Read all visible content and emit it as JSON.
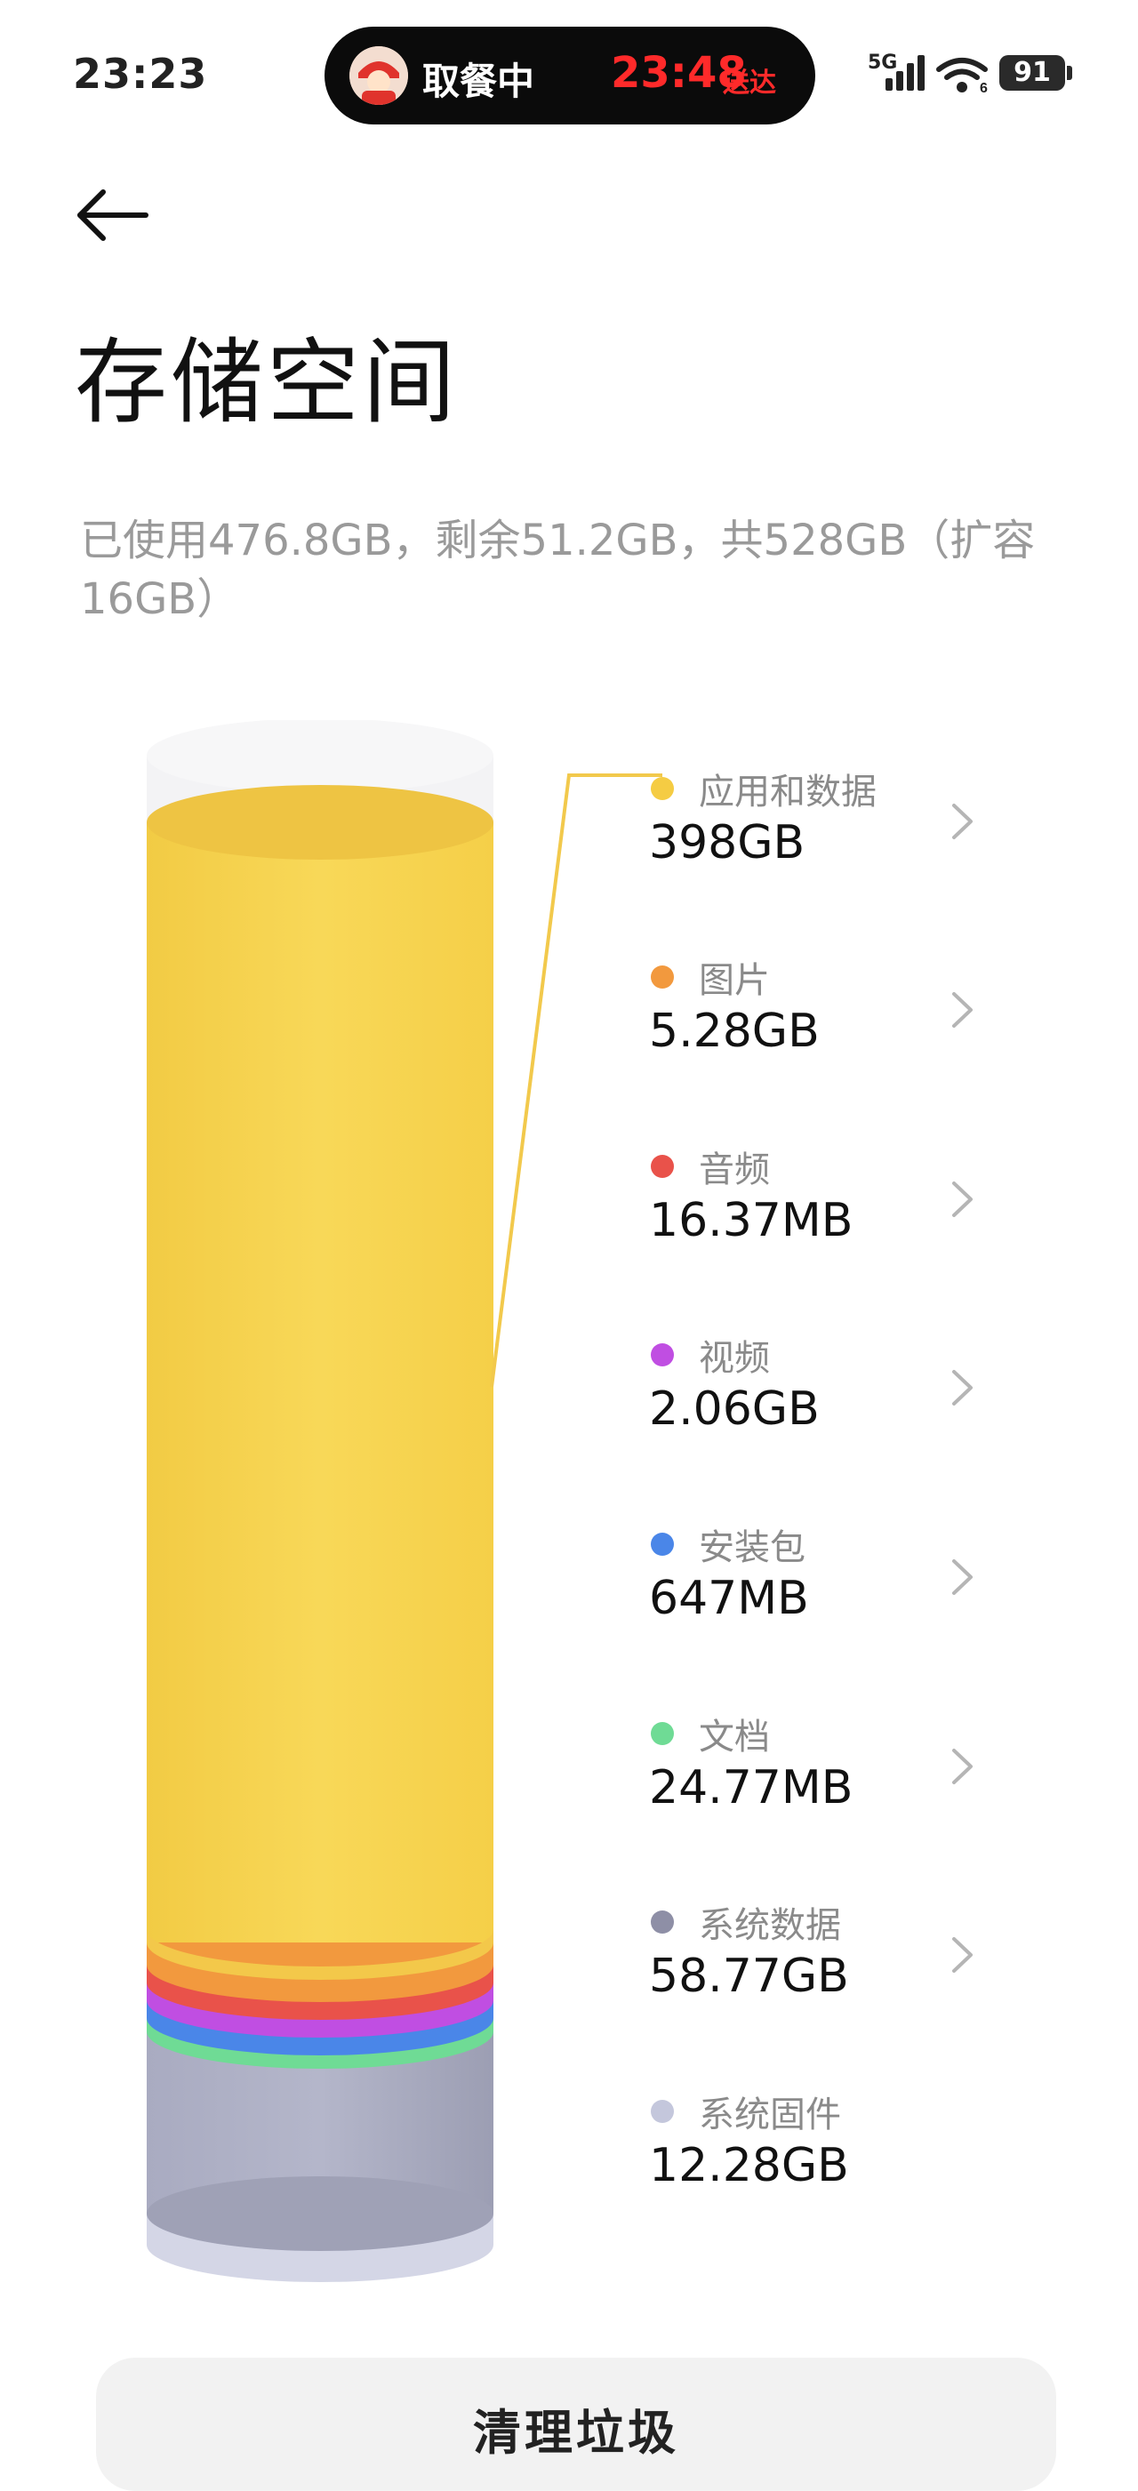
{
  "status_bar": {
    "time": "23:23",
    "island_label": "取餐中",
    "island_eta": "23:48",
    "island_eta_suffix": "送达",
    "network": "5G",
    "battery": "91"
  },
  "page": {
    "title": "存储空间",
    "summary": "已使用476.8GB，剩余51.2GB，共528GB（扩容16GB）"
  },
  "storage": [
    {
      "name": "应用和数据",
      "value": "398GB",
      "color": "#f5cc43"
    },
    {
      "name": "图片",
      "value": "5.28GB",
      "color": "#f2993e"
    },
    {
      "name": "音频",
      "value": "16.37MB",
      "color": "#e9524a"
    },
    {
      "name": "视频",
      "value": "2.06GB",
      "color": "#c04ee2"
    },
    {
      "name": "安装包",
      "value": "647MB",
      "color": "#4a86e8"
    },
    {
      "name": "文档",
      "value": "24.77MB",
      "color": "#6fdb95"
    },
    {
      "name": "系统数据",
      "value": "58.77GB",
      "color": "#8e8fa6"
    },
    {
      "name": "系统固件",
      "value": "12.28GB",
      "color": "#c4c7dc"
    }
  ],
  "actions": {
    "clean": "清理垃圾"
  }
}
